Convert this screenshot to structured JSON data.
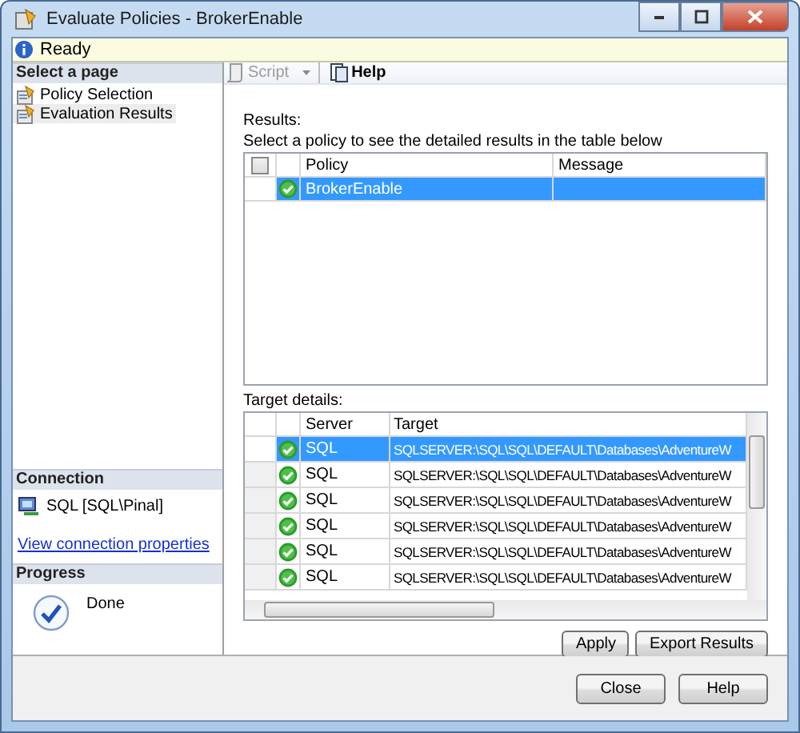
{
  "window": {
    "title": "Evaluate Policies - BrokerEnable"
  },
  "info_bar": {
    "text": "Ready"
  },
  "sidebar": {
    "header": "Select a page",
    "items": [
      {
        "label": "Policy Selection",
        "selected": false
      },
      {
        "label": "Evaluation Results",
        "selected": true
      }
    ]
  },
  "connection": {
    "header": "Connection",
    "server": "SQL [SQL\\Pinal]",
    "link": "View connection properties"
  },
  "progress": {
    "header": "Progress",
    "status": "Done"
  },
  "toolbar": [
    {
      "label": "Script",
      "kind": "script",
      "disabled": true
    },
    {
      "label": "Help",
      "kind": "help",
      "disabled": false
    }
  ],
  "results": {
    "label": "Results:",
    "instruction": "Select a policy to see the detailed results in the table below",
    "select_all_checked": false,
    "columns": [
      "Policy",
      "Message"
    ],
    "rows": [
      {
        "kind": "success",
        "policy": "BrokerEnable",
        "selected": true
      }
    ]
  },
  "target_details": {
    "label": "Target details:",
    "columns": [
      "Server",
      "Target"
    ],
    "rows": [
      {
        "kind": "success",
        "server": "SQL",
        "target": "SQLSERVER:\\SQL\\SQL\\DEFAULT\\Databases\\AdventureW",
        "selected": true
      },
      {
        "kind": "success",
        "server": "SQL",
        "target": "SQLSERVER:\\SQL\\SQL\\DEFAULT\\Databases\\AdventureW",
        "selected": false
      },
      {
        "kind": "success",
        "server": "SQL",
        "target": "SQLSERVER:\\SQL\\SQL\\DEFAULT\\Databases\\AdventureW",
        "selected": false
      },
      {
        "kind": "success",
        "server": "SQL",
        "target": "SQLSERVER:\\SQL\\SQL\\DEFAULT\\Databases\\AdventureW",
        "selected": false
      },
      {
        "kind": "success",
        "server": "SQL",
        "target": "SQLSERVER:\\SQL\\SQL\\DEFAULT\\Databases\\AdventureW",
        "selected": false
      },
      {
        "kind": "success",
        "server": "SQL",
        "target": "SQLSERVER:\\SQL\\SQL\\DEFAULT\\Databases\\AdventureW",
        "selected": false
      }
    ]
  },
  "actions": [
    "Apply",
    "Export Results"
  ],
  "buttons": [
    "Close",
    "Help"
  ]
}
